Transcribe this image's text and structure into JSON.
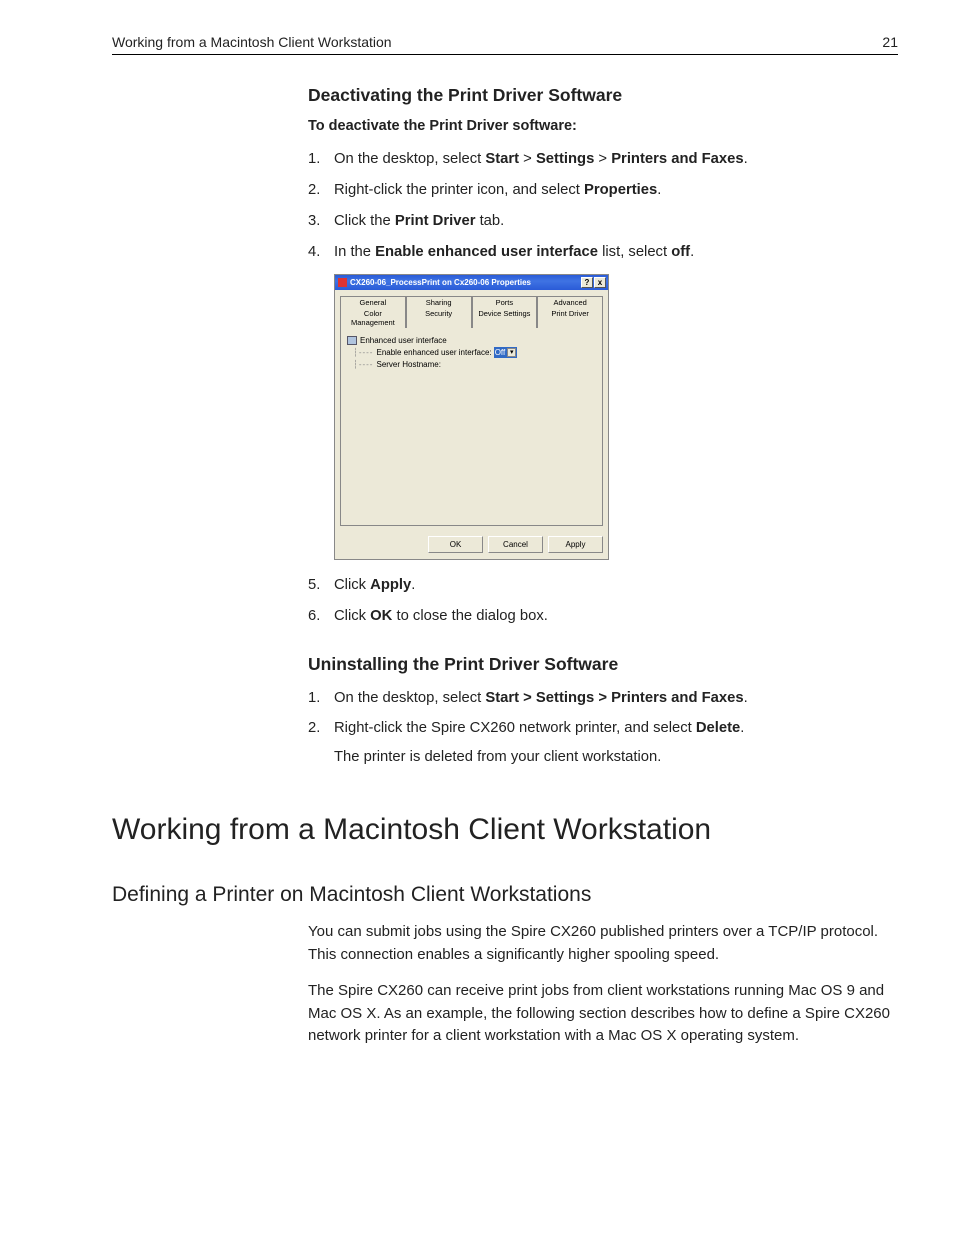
{
  "header": {
    "running_title": "Working from a Macintosh Client Workstation",
    "page_number": "21"
  },
  "sec1": {
    "title": "Deactivating the Print Driver Software",
    "lead": "To deactivate the Print Driver software:",
    "steps": {
      "s1": {
        "n": "1.",
        "pre": "On the desktop, select ",
        "b1": "Start",
        "g1": " > ",
        "b2": "Settings",
        "g2": " > ",
        "b3": "Printers and Faxes",
        "post": "."
      },
      "s2": {
        "n": "2.",
        "pre": "Right-click the printer icon, and select ",
        "b1": "Properties",
        "post": "."
      },
      "s3": {
        "n": "3.",
        "pre": "Click the ",
        "b1": "Print Driver",
        "post": " tab."
      },
      "s4": {
        "n": "4.",
        "pre": "In the ",
        "b1": "Enable enhanced user interface",
        "mid": " list, select ",
        "b2": "off",
        "post": "."
      },
      "s5": {
        "n": "5.",
        "pre": "Click ",
        "b1": "Apply",
        "post": "."
      },
      "s6": {
        "n": "6.",
        "pre": "Click ",
        "b1": "OK",
        "post": " to close the dialog box."
      }
    }
  },
  "dialog": {
    "title": "CX260-06_ProcessPrint on Cx260-06 Properties",
    "help": "?",
    "close": "x",
    "tabs_top": [
      "General",
      "Sharing",
      "Ports",
      "Advanced"
    ],
    "tabs_bottom": [
      "Color Management",
      "Security",
      "Device Settings",
      "Print Driver"
    ],
    "tree": {
      "root": "Enhanced user interface",
      "row1_label": "Enable enhanced user interface:",
      "row1_value": "Off",
      "row1_dd": "▾",
      "row2_label": "Server Hostname:"
    },
    "buttons": {
      "ok": "OK",
      "cancel": "Cancel",
      "apply": "Apply"
    }
  },
  "sec2": {
    "title": "Uninstalling the Print Driver Software",
    "s1": {
      "n": "1.",
      "pre": "On the desktop, select ",
      "b1": "Start > Settings > Printers and Faxes",
      "post": "."
    },
    "s2": {
      "n": "2.",
      "pre": "Right-click the Spire CX260 network printer, and select ",
      "b1": "Delete",
      "post": ".",
      "sub": "The printer is deleted from your client workstation."
    }
  },
  "h1": "Working from a Macintosh Client Workstation",
  "h2": "Defining a Printer on Macintosh Client Workstations",
  "p1": "You can submit jobs using the Spire CX260 published printers over a TCP/IP protocol. This connection enables a significantly higher spooling speed.",
  "p2": "The Spire CX260 can receive print jobs from client workstations running Mac OS 9 and Mac OS X. As an example, the following section describes how to define a Spire CX260 network printer for a client workstation with a Mac OS X operating system."
}
